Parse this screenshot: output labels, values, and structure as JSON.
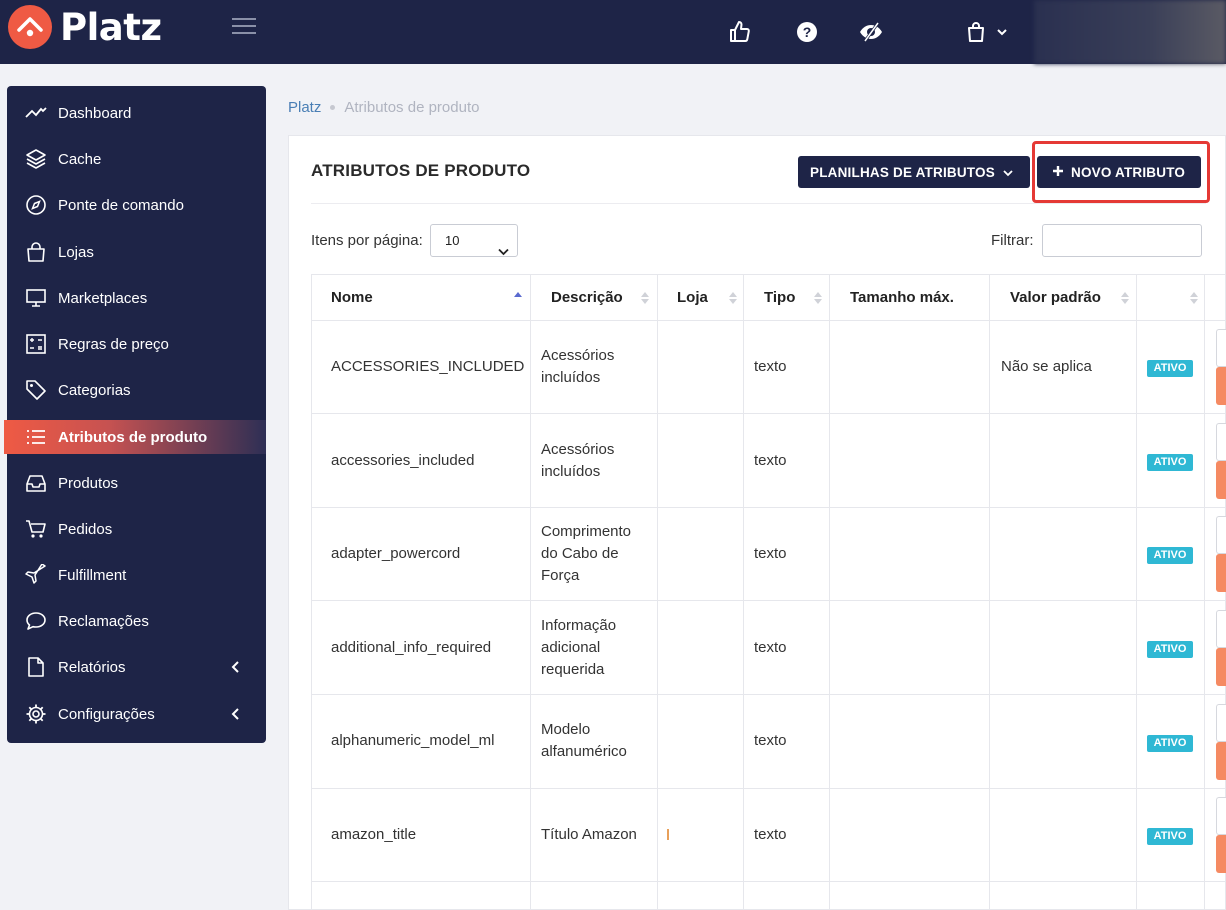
{
  "app": {
    "name": "Platz"
  },
  "sidebar": {
    "items": [
      {
        "label": "Dashboard",
        "icon": "chart-line-icon"
      },
      {
        "label": "Cache",
        "icon": "layers-icon"
      },
      {
        "label": "Ponte de comando",
        "icon": "compass-icon"
      },
      {
        "label": "Lojas",
        "icon": "shopping-bag-icon"
      },
      {
        "label": "Marketplaces",
        "icon": "monitor-icon"
      },
      {
        "label": "Regras de preço",
        "icon": "calculator-icon"
      },
      {
        "label": "Categorias",
        "icon": "tag-icon"
      },
      {
        "label": "Atributos de produto",
        "icon": "list-icon",
        "active": true
      },
      {
        "label": "Produtos",
        "icon": "inbox-icon"
      },
      {
        "label": "Pedidos",
        "icon": "cart-icon"
      },
      {
        "label": "Fulfillment",
        "icon": "plane-icon"
      },
      {
        "label": "Reclamações",
        "icon": "chat-icon"
      },
      {
        "label": "Relatórios",
        "icon": "file-icon"
      },
      {
        "label": "Configurações",
        "icon": "gear-icon"
      }
    ]
  },
  "breadcrumb": {
    "root": "Platz",
    "current": "Atributos de produto"
  },
  "page": {
    "title": "ATRIBUTOS DE PRODUTO",
    "sheets_button": "PLANILHAS DE ATRIBUTOS",
    "new_button": "NOVO ATRIBUTO",
    "per_page_label": "Itens por página:",
    "per_page_value": "10",
    "filter_label": "Filtrar:",
    "filter_value": ""
  },
  "table": {
    "columns": [
      "Nome",
      "Descrição",
      "Loja",
      "Tipo",
      "Tamanho máx.",
      "Valor padrão"
    ],
    "rows": [
      {
        "name": "ACCESSORIES_INCLUDED",
        "desc": [
          "Acessórios",
          "incluídos"
        ],
        "store": "",
        "type": "texto",
        "max": "",
        "default": "Não se aplica",
        "status": "ATIVO"
      },
      {
        "name": "accessories_included",
        "desc": [
          "Acessórios",
          "incluídos"
        ],
        "store": "",
        "type": "texto",
        "max": "",
        "default": "",
        "status": "ATIVO"
      },
      {
        "name": "adapter_powercord",
        "desc": [
          "Comprimento",
          "do Cabo de",
          "Força"
        ],
        "store": "",
        "type": "texto",
        "max": "",
        "default": "",
        "status": "ATIVO"
      },
      {
        "name": "additional_info_required",
        "desc": [
          "Informação",
          "adicional",
          "requerida"
        ],
        "store": "",
        "type": "texto",
        "max": "",
        "default": "",
        "status": "ATIVO"
      },
      {
        "name": "alphanumeric_model_ml",
        "desc": [
          "Modelo",
          "alfanumérico"
        ],
        "store": "",
        "type": "texto",
        "max": "",
        "default": "",
        "status": "ATIVO"
      },
      {
        "name": "amazon_title",
        "desc": [
          "Título Amazon"
        ],
        "store": "",
        "type": "texto",
        "max": "",
        "default": "",
        "status": "ATIVO"
      }
    ]
  },
  "colors": {
    "navy": "#1e2447",
    "accent": "#ef5a44",
    "badge": "#2fb8d4"
  }
}
